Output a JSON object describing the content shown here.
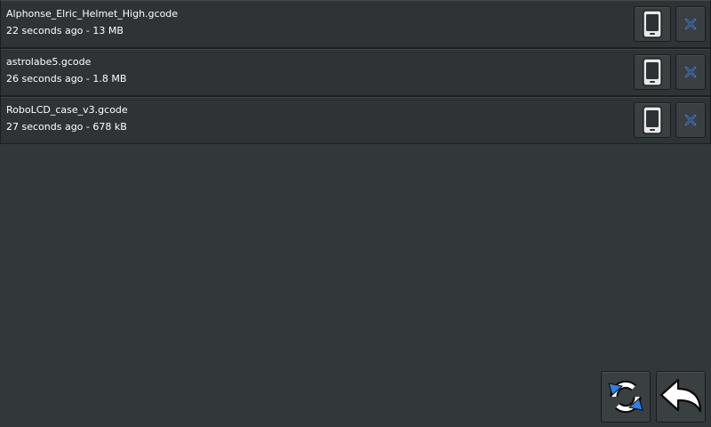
{
  "files": [
    {
      "name": "Alphonse_Elric_Helmet_High.gcode",
      "meta": "22 seconds ago - 13 MB"
    },
    {
      "name": "astrolabe5.gcode",
      "meta": "26 seconds ago - 1.8 MB"
    },
    {
      "name": "RoboLCD_case_v3.gcode",
      "meta": "27 seconds ago - 678 kB"
    }
  ],
  "icons": {
    "device": "device-icon",
    "delete": "close-icon",
    "refresh": "refresh-icon",
    "back": "back-arrow-icon"
  },
  "colors": {
    "background": "#32373a",
    "accent_blue": "#2f7fe6",
    "delete_blue": "#4a7fd6"
  }
}
